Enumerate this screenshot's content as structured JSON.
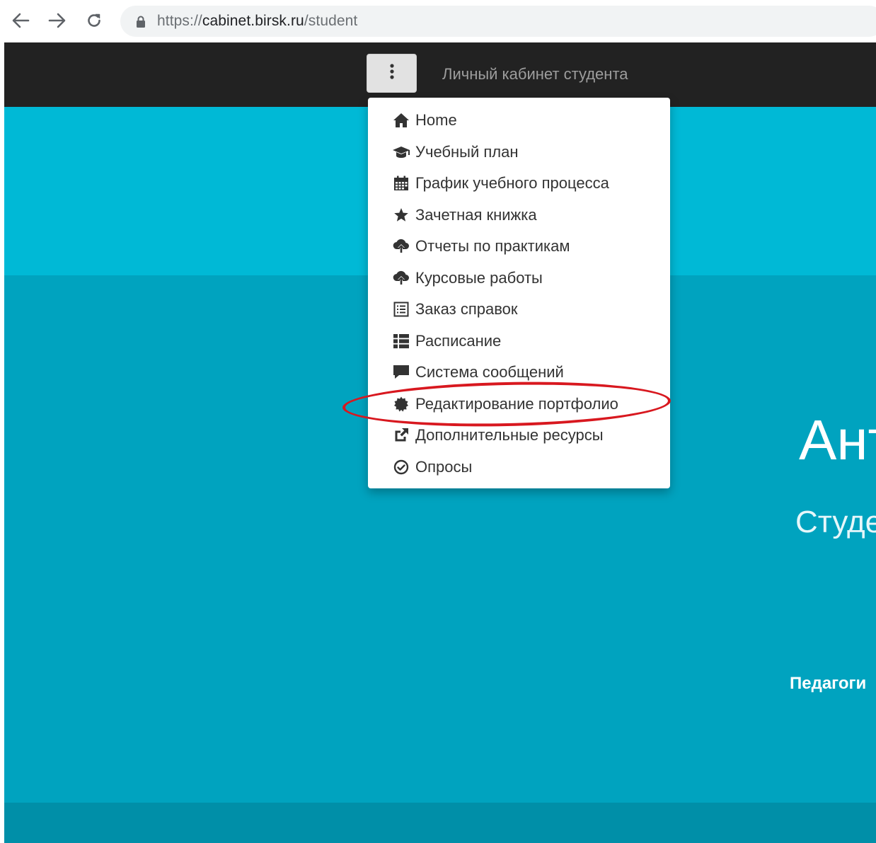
{
  "browser": {
    "url_proto": "https://",
    "url_host": "cabinet.birsk.ru",
    "url_path": "/student",
    "icons": [
      "back-arrow-icon",
      "forward-arrow-icon",
      "reload-icon",
      "lock-icon"
    ]
  },
  "navbar": {
    "brand": "Личный кабинет студента",
    "toggle_icon": "vertical-ellipsis-icon"
  },
  "menu": {
    "items": [
      {
        "label": "Home",
        "icon": "home-icon"
      },
      {
        "label": "Учебный план",
        "icon": "graduation-cap-icon"
      },
      {
        "label": "График учебного процесса",
        "icon": "calendar-icon"
      },
      {
        "label": "Зачетная книжка",
        "icon": "star-icon"
      },
      {
        "label": "Отчеты по практикам",
        "icon": "cloud-upload-icon"
      },
      {
        "label": "Курсовые работы",
        "icon": "cloud-upload-icon"
      },
      {
        "label": "Заказ справок",
        "icon": "list-alt-icon"
      },
      {
        "label": "Расписание",
        "icon": "th-list-icon"
      },
      {
        "label": "Система сообщений",
        "icon": "comment-icon"
      },
      {
        "label": "Редактирование портфолио",
        "icon": "certificate-icon"
      },
      {
        "label": "Дополнительные ресурсы",
        "icon": "share-square-icon"
      },
      {
        "label": "Опросы",
        "icon": "check-circle-icon"
      }
    ],
    "highlighted_item": "Редактирование портфолио",
    "highlight_color": "#d8181f"
  },
  "hero": {
    "name_partial": "Ант",
    "role_partial": "Студе",
    "faculty_partial": "Педагоги"
  },
  "colors": {
    "navbar": "#222222",
    "band_top": "#00b9d6",
    "band_main": "#00a3bf",
    "band_bottom": "#008fa8"
  }
}
